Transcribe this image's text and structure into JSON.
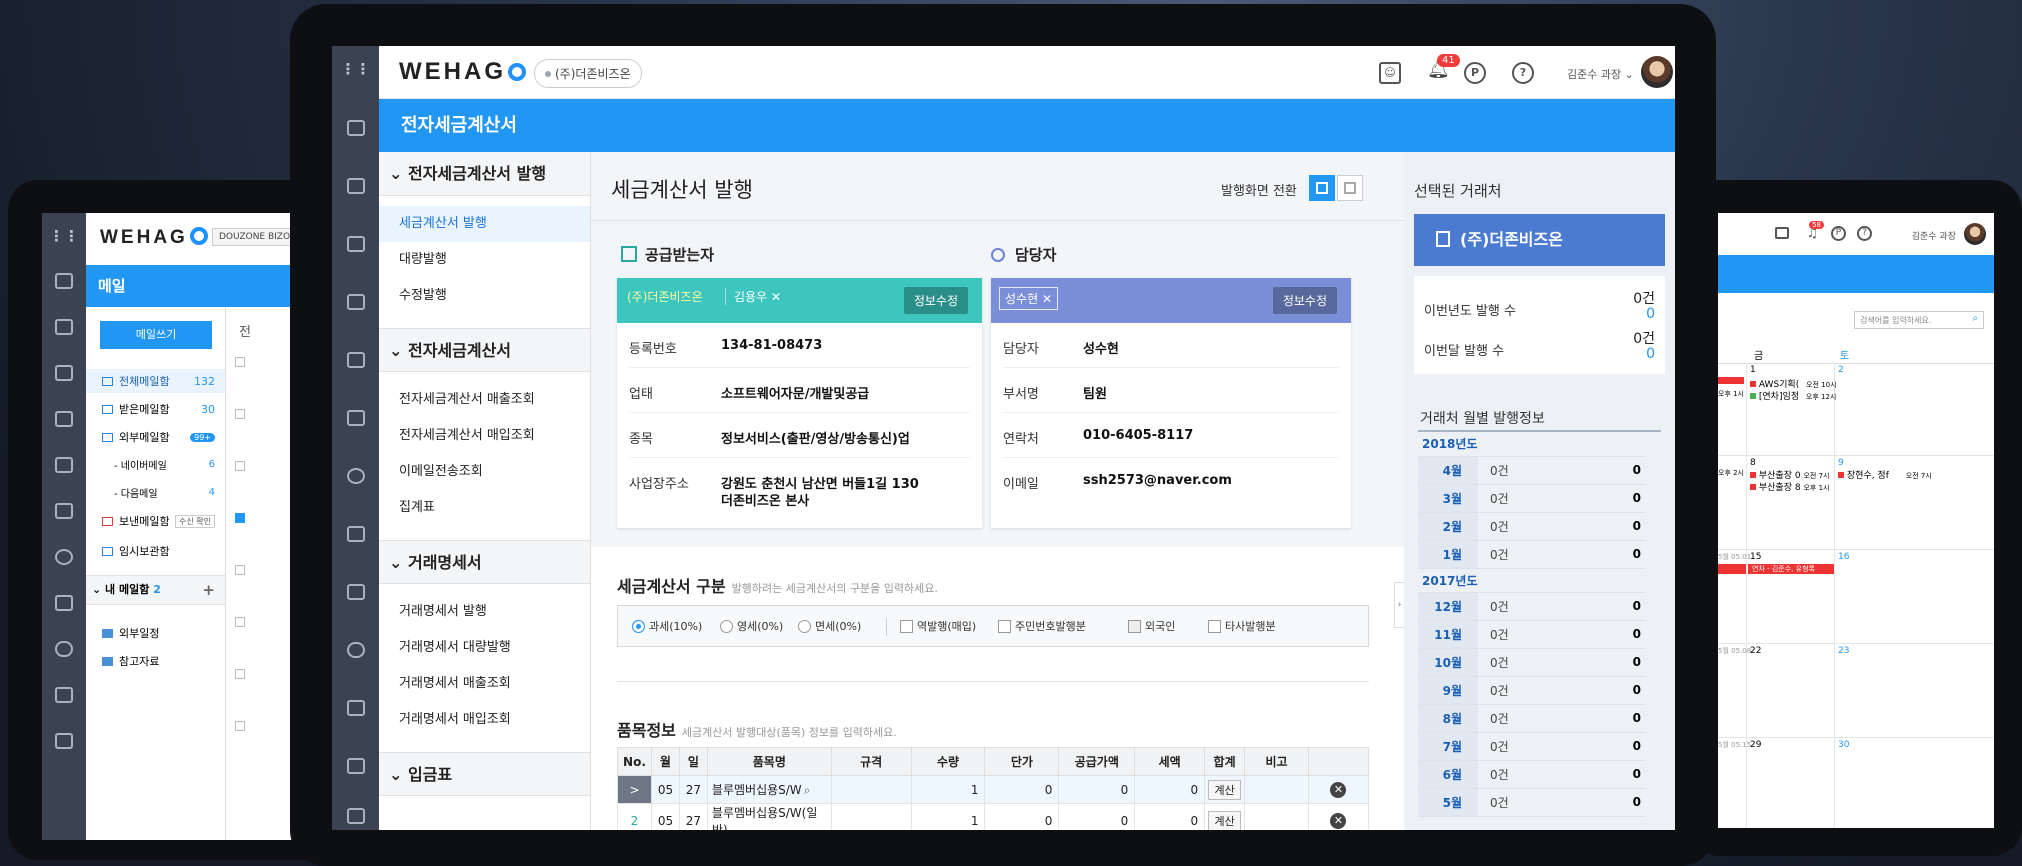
{
  "left_device": {
    "logo": "WEHAG",
    "company": "DOUZONE BIZO",
    "header": "메일",
    "compose_button": "메일쓰기",
    "items": [
      {
        "label": "전체메일함",
        "count": "132"
      },
      {
        "label": "받은메일함",
        "count": "30"
      },
      {
        "label": "외부메일함",
        "count": "99+"
      },
      {
        "label": "- 네이버메일",
        "count": "6"
      },
      {
        "label": "- 다음메일",
        "count": "4"
      },
      {
        "label": "보낸메일함",
        "count": "수신 확인"
      },
      {
        "label": "임시보관함",
        "count": ""
      }
    ],
    "my_mailbox": "내 메일함",
    "my_mailbox_count": "2",
    "folders": [
      "외부일정",
      "참고자료"
    ],
    "list_header": "전"
  },
  "app": {
    "logo": "WEHAG",
    "company": "(주)더존비즈온",
    "notification_count": "41",
    "user": "김준수 과장",
    "title_bar": "전자세금계산서"
  },
  "menu": {
    "sections": [
      {
        "title": "전자세금계산서 발행",
        "items": [
          "세금계산서 발행",
          "대량발행",
          "수정발행"
        ]
      },
      {
        "title": "전자세금계산서",
        "items": [
          "전자세금계산서 매출조회",
          "전자세금계산서 매입조회",
          "이메일전송조회",
          "집계표"
        ]
      },
      {
        "title": "거래명세서",
        "items": [
          "거래명세서 발행",
          "거래명세서 대량발행",
          "거래명세서 매출조회",
          "거래명세서 매입조회"
        ]
      },
      {
        "title": "입금표",
        "items": []
      }
    ]
  },
  "main": {
    "page_title": "세금계산서 발행",
    "view_toggle_label": "발행화면 전환",
    "receiver": {
      "title": "공급받는자",
      "company_chip": "(주)더존비즈온",
      "person_chip": "김용우",
      "edit": "정보수정",
      "rows": [
        {
          "label": "등록번호",
          "value": "134-81-08473"
        },
        {
          "label": "업태",
          "value": "소프트웨어자문/개발및공급"
        },
        {
          "label": "종목",
          "value": "정보서비스(출판/영상/방송통신)업"
        },
        {
          "label": "사업장주소",
          "value": "강원도 춘천시 남산면 버들1길 130",
          "value2": "더존비즈온 본사"
        }
      ]
    },
    "manager": {
      "title": "담당자",
      "chip": "성수현",
      "edit": "정보수정",
      "rows": [
        {
          "label": "담당자",
          "value": "성수현"
        },
        {
          "label": "부서명",
          "value": "팀원"
        },
        {
          "label": "연락처",
          "value": "010-6405-8117"
        },
        {
          "label": "이메일",
          "value": "ssh2573@naver.com"
        }
      ]
    },
    "tax_type": {
      "title": "세금계산서 구분",
      "hint": "발행하려는 세금계산서의 구분을 입력하세요.",
      "radios": [
        "과세(10%)",
        "영세(0%)",
        "면세(0%)"
      ],
      "checks": [
        "역발행(매입)",
        "주민번호발행분",
        "외국인",
        "타사발행분"
      ]
    },
    "items": {
      "title": "품목정보",
      "hint": "세금계산서 발행대상(품목) 정보를 입력하세요.",
      "columns": [
        "No.",
        "월",
        "일",
        "품목명",
        "규격",
        "수량",
        "단가",
        "공급가액",
        "세액",
        "합계",
        "비고"
      ],
      "rows": [
        {
          "no": ">",
          "month": "05",
          "day": "27",
          "name": "블루멤버십용S/W",
          "spec": "",
          "qty": "1",
          "price": "0",
          "supply": "0",
          "tax": "0",
          "sum": "계산",
          "note": ""
        },
        {
          "no": "2",
          "month": "05",
          "day": "27",
          "name": "블루멤버십용S/W(일반)",
          "spec": "",
          "qty": "1",
          "price": "0",
          "supply": "0",
          "tax": "0",
          "sum": "계산",
          "note": ""
        }
      ]
    }
  },
  "right_panel": {
    "title": "선택된 거래처",
    "selected": "(주)더존비즈온",
    "stats": [
      {
        "label": "이번년도 발행 수",
        "a": "0건",
        "b": "0"
      },
      {
        "label": "이번달 발행 수",
        "a": "0건",
        "b": "0"
      }
    ],
    "monthly_title": "거래처 월별 발행정보",
    "years": [
      {
        "year": "2018년도",
        "months": [
          {
            "m": "4월",
            "c": "0건",
            "v": "0"
          },
          {
            "m": "3월",
            "c": "0건",
            "v": "0"
          },
          {
            "m": "2월",
            "c": "0건",
            "v": "0"
          },
          {
            "m": "1월",
            "c": "0건",
            "v": "0"
          }
        ]
      },
      {
        "year": "2017년도",
        "months": [
          {
            "m": "12월",
            "c": "0건",
            "v": "0"
          },
          {
            "m": "11월",
            "c": "0건",
            "v": "0"
          },
          {
            "m": "10월",
            "c": "0건",
            "v": "0"
          },
          {
            "m": "9월",
            "c": "0건",
            "v": "0"
          },
          {
            "m": "8월",
            "c": "0건",
            "v": "0"
          },
          {
            "m": "7월",
            "c": "0건",
            "v": "0"
          },
          {
            "m": "6월",
            "c": "0건",
            "v": "0"
          },
          {
            "m": "5월",
            "c": "0건",
            "v": "0"
          }
        ]
      }
    ]
  },
  "right_device": {
    "user": "김준수 과장",
    "badge": "58",
    "search_placeholder": "검색어를 입력하세요.",
    "day_headers": [
      "금",
      "토"
    ],
    "cells": [
      {
        "date": "1",
        "events": [
          "AWS기획(",
          "[연차]임정"
        ],
        "times": [
          "오전 10시",
          "오후 12시"
        ]
      },
      {
        "date": "2",
        "events": [],
        "times": []
      },
      {
        "date": "8",
        "events": [
          "부산출장 0",
          "부산출장 8"
        ],
        "times": [
          "오전 7시",
          "오후 1시"
        ]
      },
      {
        "date": "9",
        "events": [
          "장현수, 정f"
        ],
        "times": [
          "오전 7시"
        ]
      },
      {
        "date": "15",
        "events": [
          "연차 - 김준수, 유형록"
        ],
        "times": []
      },
      {
        "date": "16",
        "events": [],
        "times": []
      },
      {
        "date": "22",
        "events": [],
        "times": []
      },
      {
        "date": "23",
        "events": [],
        "times": []
      },
      {
        "date": "29",
        "events": [],
        "times": []
      },
      {
        "date": "30",
        "events": [],
        "times": []
      }
    ],
    "left_labels": [
      "오후 1시",
      "오후 2시",
      "5월 05.01",
      "5월 05.08",
      "5월 05.15"
    ]
  },
  "colors": {
    "accent": "#2296f3",
    "teal": "#3cc6be",
    "purple": "#7b8fd8",
    "red": "#f23b3b"
  }
}
